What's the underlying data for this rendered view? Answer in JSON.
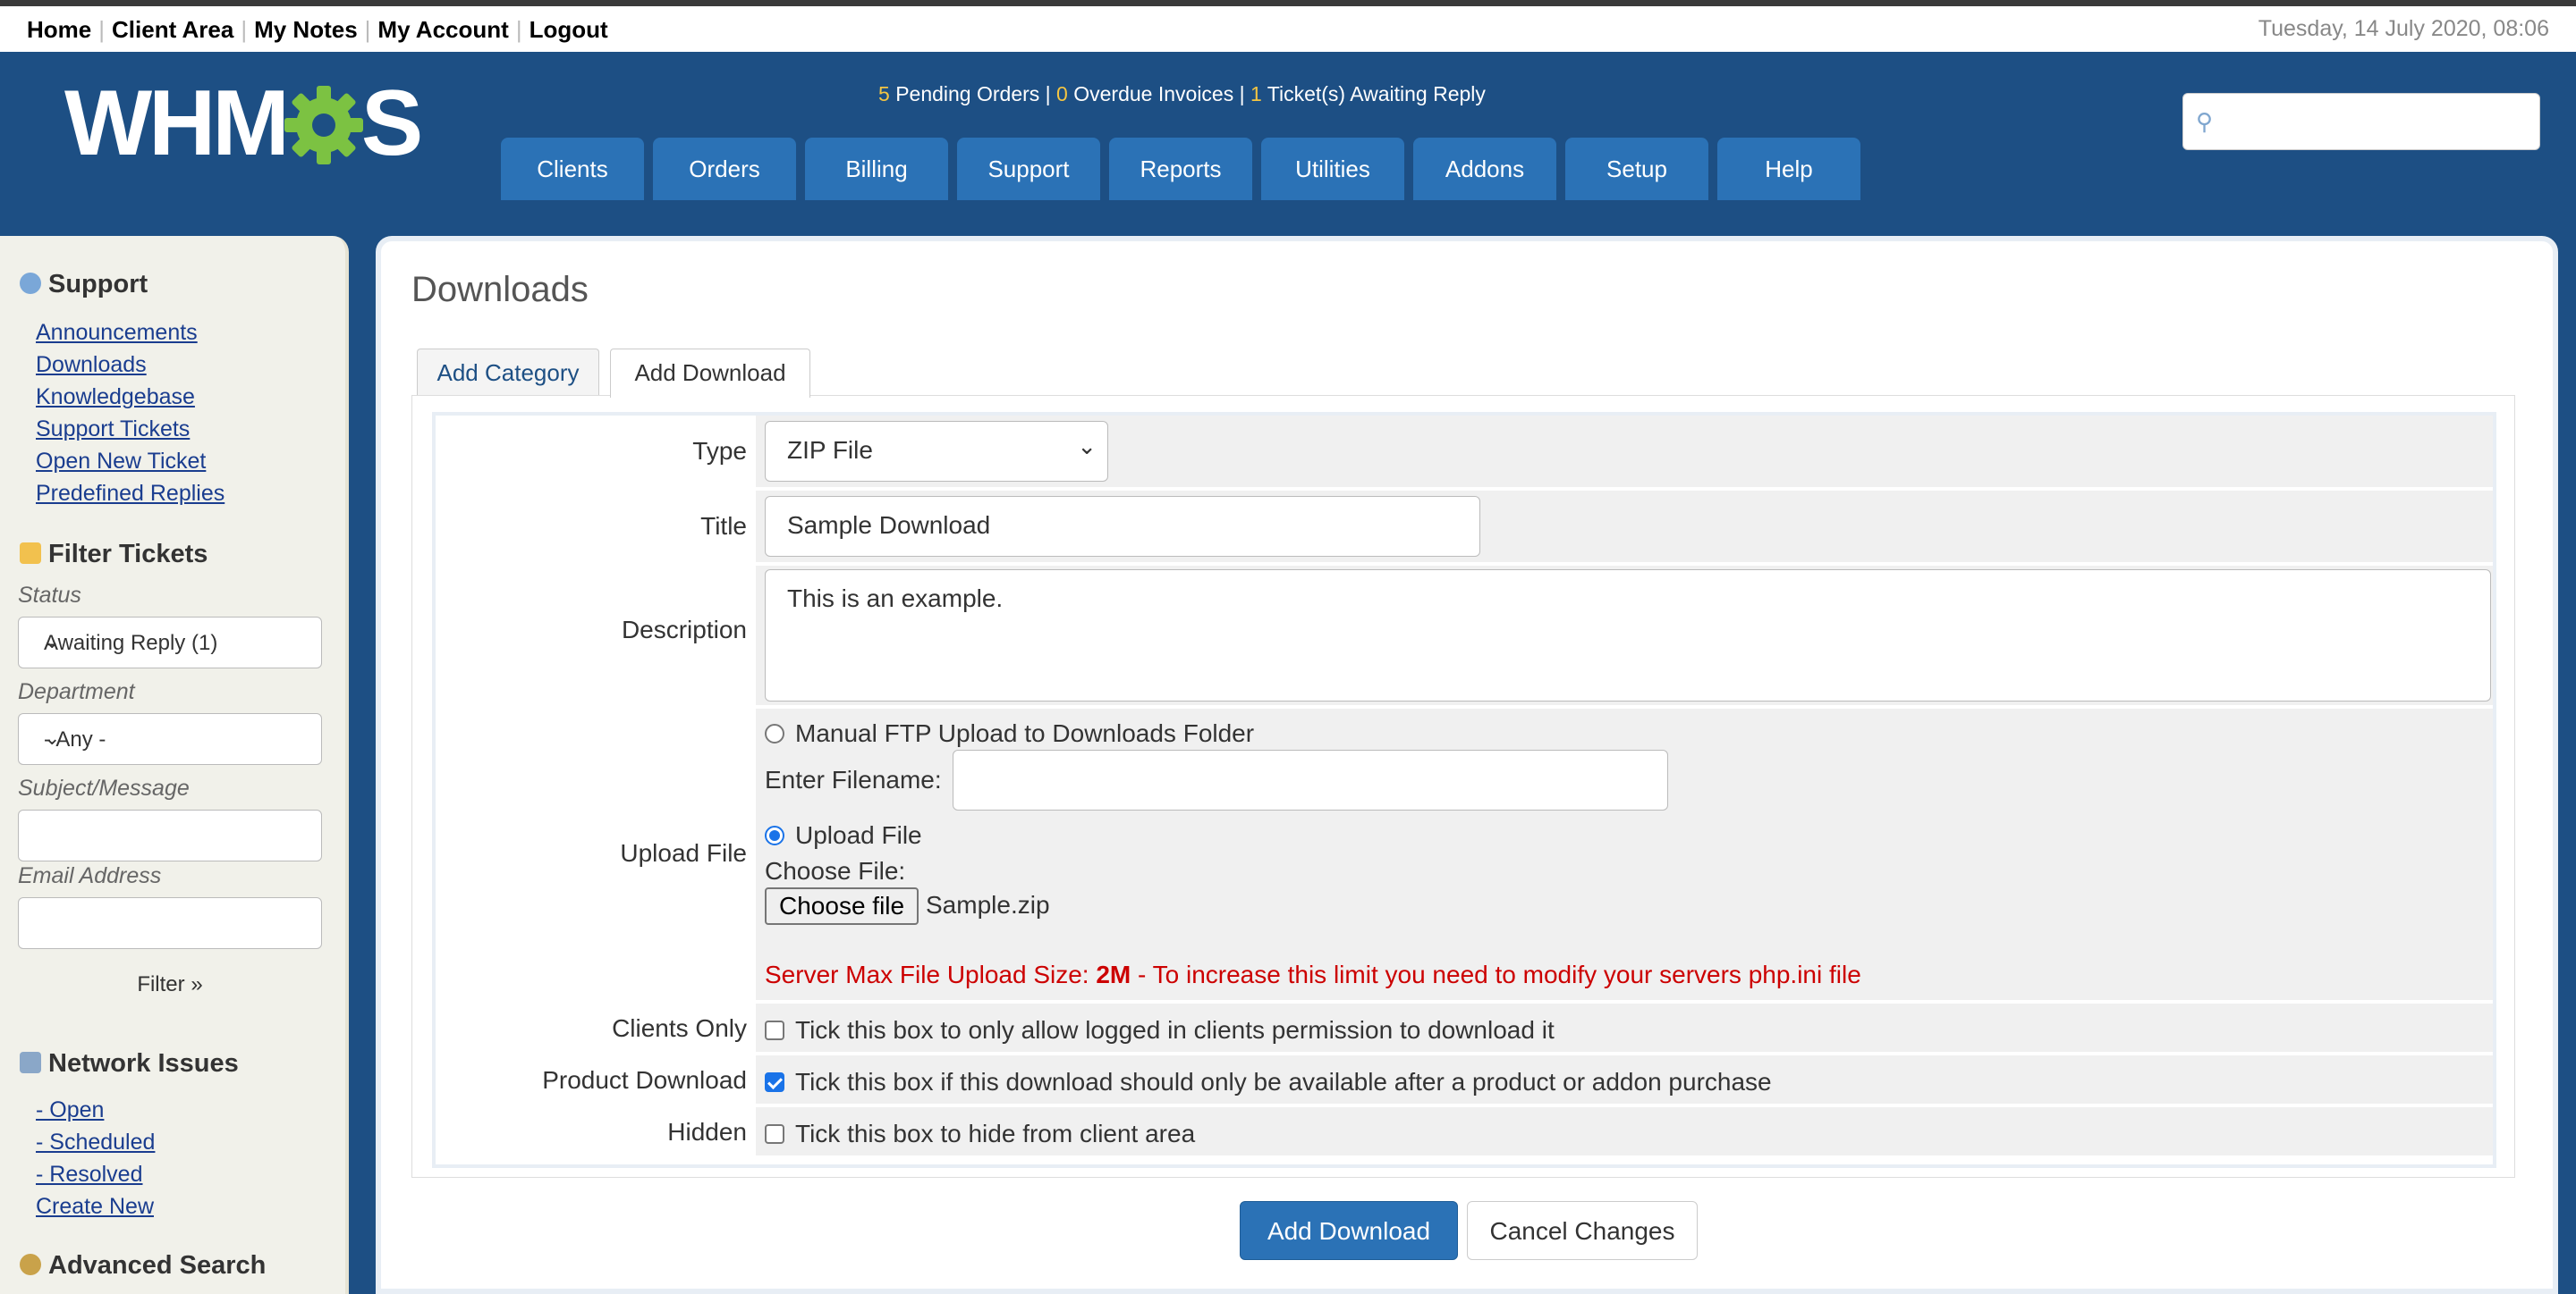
{
  "topbar": {
    "links": [
      "Home",
      "Client Area",
      "My Notes",
      "My Account",
      "Logout"
    ],
    "date": "Tuesday, 14 July 2020, 08:06"
  },
  "logo": {
    "part1": "WHM",
    "part2": "S"
  },
  "stats": {
    "pending_orders_count": "5",
    "pending_orders_label": "Pending Orders |",
    "overdue_count": "0",
    "overdue_label": "Overdue Invoices |",
    "tickets_count": "1",
    "tickets_label": "Ticket(s) Awaiting Reply"
  },
  "nav": [
    "Clients",
    "Orders",
    "Billing",
    "Support",
    "Reports",
    "Utilities",
    "Addons",
    "Setup",
    "Help"
  ],
  "search": {
    "placeholder": ""
  },
  "sidebar": {
    "support_heading": "Support",
    "support_links": [
      "Announcements",
      "Downloads",
      "Knowledgebase",
      "Support Tickets",
      "Open New Ticket",
      "Predefined Replies"
    ],
    "filter_heading": "Filter Tickets",
    "status_label": "Status",
    "status_value": "Awaiting Reply (1)",
    "department_label": "Department",
    "department_value": "- Any -",
    "subject_label": "Subject/Message",
    "email_label": "Email Address",
    "filter_button": "Filter »",
    "network_heading": "Network Issues",
    "network_links": [
      "- Open",
      "- Scheduled",
      "- Resolved",
      "Create New"
    ],
    "advanced_heading": "Advanced Search"
  },
  "colors": {
    "header_bg": "#1d4f84",
    "nav_tab": "#2b72b6",
    "accent_yellow": "#f4c542",
    "warn_red": "#cc0000"
  },
  "page": {
    "title": "Downloads",
    "tabs": [
      "Add Category",
      "Add Download"
    ],
    "active_tab": "Add Download"
  },
  "form": {
    "type_label": "Type",
    "type_value": "ZIP File",
    "title_label": "Title",
    "title_value": "Sample Download",
    "description_label": "Description",
    "description_value": "This is an example.",
    "upload_label": "Upload File",
    "manual_ftp_label": "Manual FTP Upload to Downloads Folder",
    "filename_label": "Enter Filename:",
    "filename_value": "",
    "upload_option_label": "Upload File",
    "choose_file_label": "Choose File:",
    "choose_file_button": "Choose file",
    "chosen_file": "Sample.zip",
    "max_size_prefix": "Server Max File Upload Size: ",
    "max_size_value": "2M",
    "max_size_suffix": " - To increase this limit you need to modify your servers php.ini file",
    "clients_only_label": "Clients Only",
    "clients_only_text": "Tick this box to only allow logged in clients permission to download it",
    "clients_only_checked": false,
    "product_download_label": "Product Download",
    "product_download_text": "Tick this box if this download should only be available after a product or addon purchase",
    "product_download_checked": true,
    "hidden_label": "Hidden",
    "hidden_text": "Tick this box to hide from client area",
    "hidden_checked": false,
    "submit_button": "Add Download",
    "cancel_button": "Cancel Changes"
  }
}
